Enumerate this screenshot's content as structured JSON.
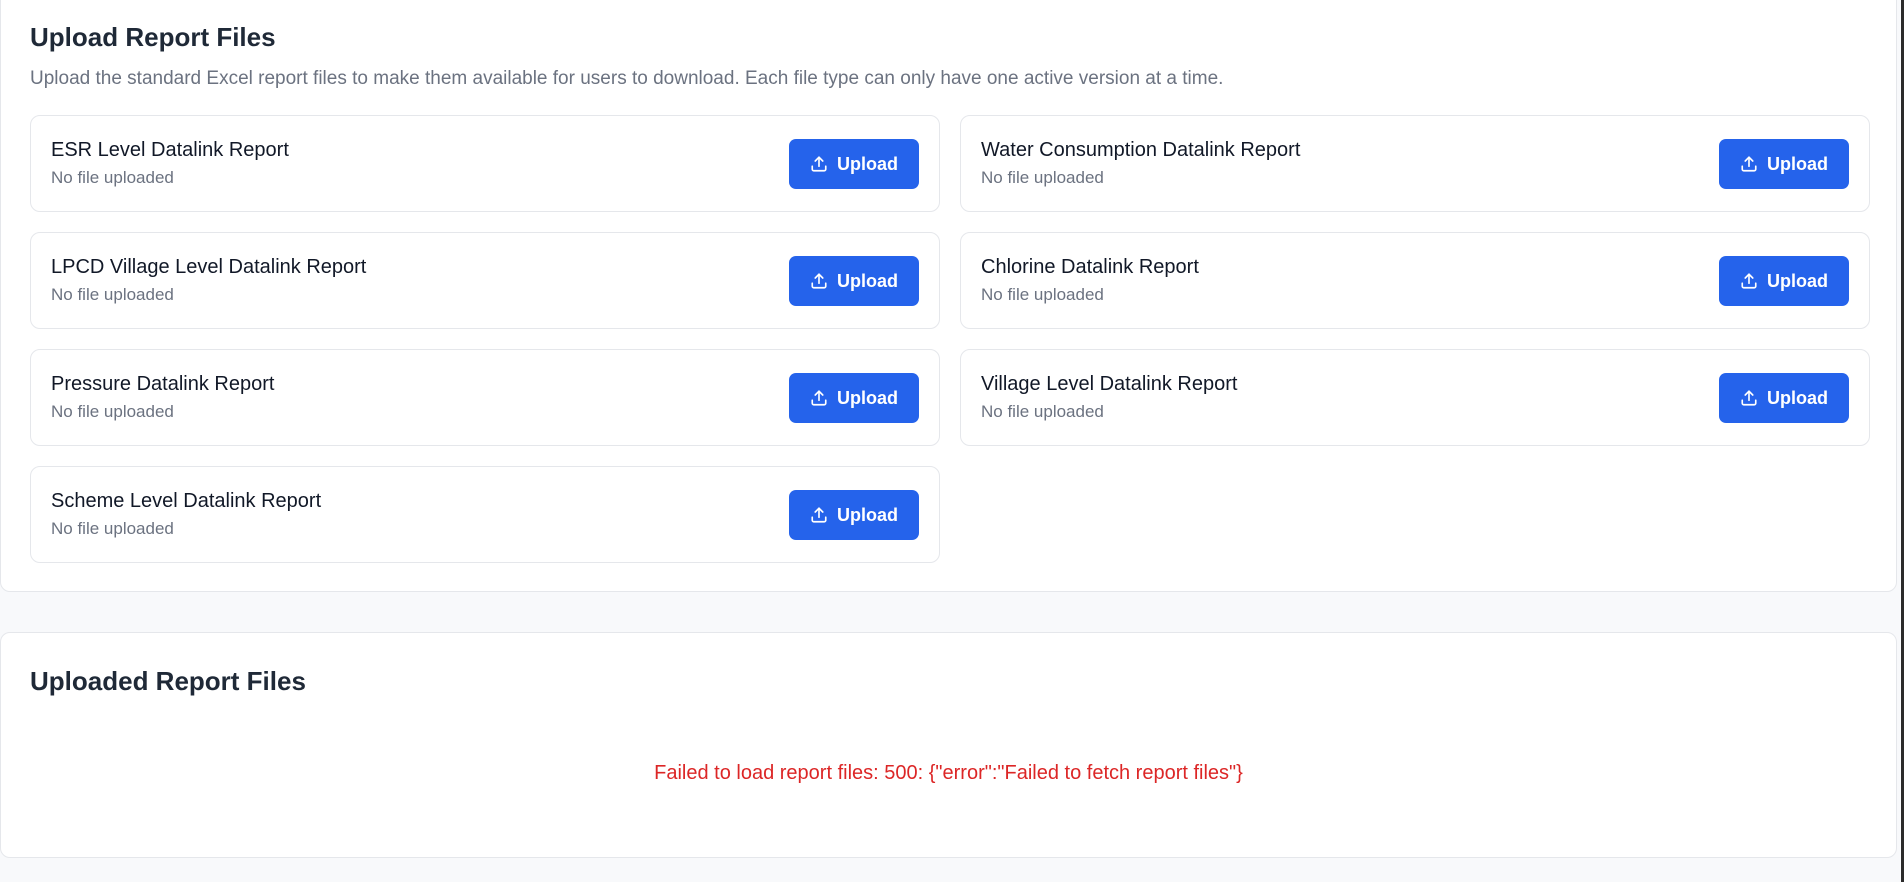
{
  "upload_section": {
    "title": "Upload Report Files",
    "description": "Upload the standard Excel report files to make them available for users to download. Each file type can only have one active version at a time.",
    "upload_label": "Upload",
    "reports": [
      {
        "name": "ESR Level Datalink Report",
        "status": "No file uploaded"
      },
      {
        "name": "Water Consumption Datalink Report",
        "status": "No file uploaded"
      },
      {
        "name": "LPCD Village Level Datalink Report",
        "status": "No file uploaded"
      },
      {
        "name": "Chlorine Datalink Report",
        "status": "No file uploaded"
      },
      {
        "name": "Pressure Datalink Report",
        "status": "No file uploaded"
      },
      {
        "name": "Village Level Datalink Report",
        "status": "No file uploaded"
      },
      {
        "name": "Scheme Level Datalink Report",
        "status": "No file uploaded"
      }
    ]
  },
  "uploaded_section": {
    "title": "Uploaded Report Files",
    "error_message": "Failed to load report files: 500: {\"error\":\"Failed to fetch report files\"}"
  },
  "icons": {
    "upload": "upload-icon"
  },
  "colors": {
    "accent": "#2563eb",
    "error": "#dc2626",
    "muted_text": "#6b7280",
    "background": "#f8f9fb"
  }
}
